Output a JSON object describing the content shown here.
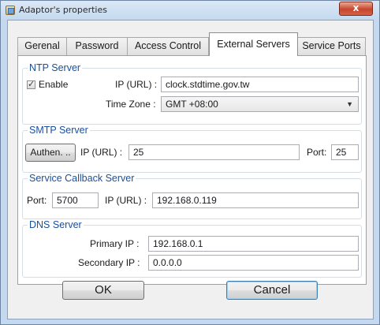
{
  "window": {
    "title": "Adaptor's properties",
    "close_label": "x"
  },
  "tabs": [
    {
      "label": "Gerenal"
    },
    {
      "label": "Password"
    },
    {
      "label": "Access Control"
    },
    {
      "label": "External Servers",
      "active": true
    },
    {
      "label": "Service Ports"
    }
  ],
  "ntp": {
    "title": "NTP Server",
    "enable_label": "Enable",
    "enable_checked": true,
    "ip_label": "IP (URL) :",
    "ip_value": "clock.stdtime.gov.tw",
    "timezone_label": "Time Zone :",
    "timezone_value": "GMT +08:00"
  },
  "smtp": {
    "title": "SMTP Server",
    "authen_label": "Authen. ..",
    "ip_label": "IP (URL) :",
    "ip_value": "25",
    "port_label": "Port:",
    "port_value": "25"
  },
  "callback": {
    "title": "Service Callback Server",
    "port_label": "Port:",
    "port_value": "5700",
    "ip_label": "IP (URL) :",
    "ip_value": "192.168.0.119"
  },
  "dns": {
    "title": "DNS Server",
    "primary_label": "Primary IP :",
    "primary_value": "192.168.0.1",
    "secondary_label": "Secondary IP :",
    "secondary_value": "0.0.0.0"
  },
  "buttons": {
    "ok_label": "OK",
    "cancel_label": "Cancel"
  }
}
